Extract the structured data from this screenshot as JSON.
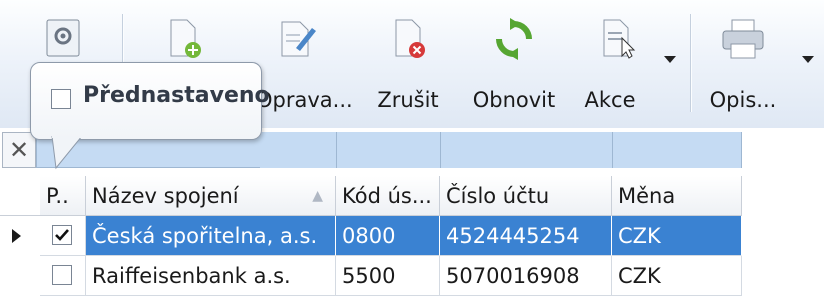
{
  "toolbar": {
    "settings_tooltip_icon": "gear-icon",
    "buttons": [
      {
        "label": "Opravа...",
        "icon": "edit-icon"
      },
      {
        "label": "Zrušit",
        "icon": "delete-document-icon"
      },
      {
        "label": "Obnovit",
        "icon": "refresh-icon"
      },
      {
        "label": "Akce",
        "icon": "cursor-document-icon"
      },
      {
        "label": "Opis...",
        "icon": "printer-icon"
      }
    ],
    "new_icon": "new-document-icon"
  },
  "popup": {
    "checkbox_label": "Přednastaveno",
    "checked": false
  },
  "grid": {
    "columns": [
      "P..",
      "Název spojení",
      "Kód ús...",
      "Číslo účtu",
      "Měna"
    ],
    "rows": [
      {
        "checked": true,
        "name": "Česká spořitelna, a.s.",
        "code": "0800",
        "account": "4524445254",
        "currency": "CZK",
        "selected": true
      },
      {
        "checked": false,
        "name": "Raiffeisenbank a.s.",
        "code": "5500",
        "account": "5070016908",
        "currency": "CZK",
        "selected": false
      }
    ]
  },
  "colors": {
    "selection": "#3a82d2",
    "filter_row": "#c5dbf3"
  }
}
